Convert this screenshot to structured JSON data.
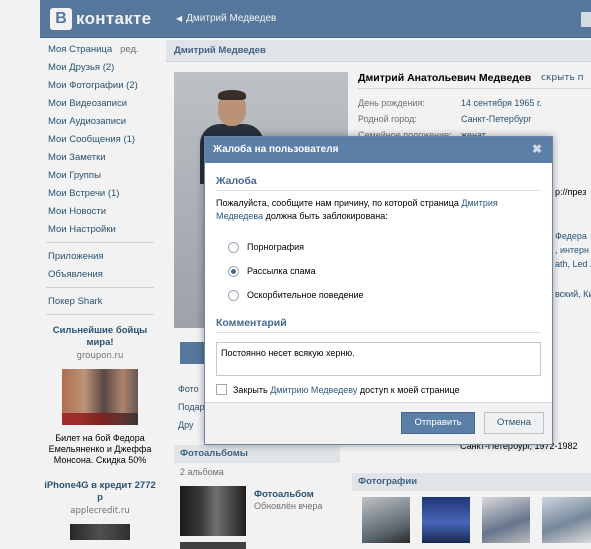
{
  "topbar": {
    "logo_letter": "В",
    "logo_text": "контакте",
    "back_link": "Дмитрий Медведев"
  },
  "menu": {
    "items": [
      {
        "label": "Моя Страница",
        "extra": "ред."
      },
      {
        "label": "Мои Друзья (2)"
      },
      {
        "label": "Мои Фотографии (2)"
      },
      {
        "label": "Мои Видеозаписи"
      },
      {
        "label": "Мои Аудиозаписи"
      },
      {
        "label": "Мои Сообщения (1)"
      },
      {
        "label": "Мои Заметки"
      },
      {
        "label": "Мои Группы"
      },
      {
        "label": "Мои Встречи (1)"
      },
      {
        "label": "Мои Новости"
      },
      {
        "label": "Мои Настройки"
      }
    ],
    "extra_items": [
      "Приложения",
      "Объявления"
    ],
    "game": "Покер Shark"
  },
  "ads": [
    {
      "title": "Сильнейшие бойцы мира!",
      "source": "groupon.ru",
      "text": "Билет на бой Федора Емельяненко и Джеффа Монсона. Скидка 50%"
    },
    {
      "title": "iPhone4G в кредит 2772 р",
      "source": "applecredit.ru"
    }
  ],
  "content": {
    "header": "Дмитрий Медведев",
    "profile_name": "Дмитрий Анатольевич Медведев",
    "hide_link": "скрыть п",
    "info": [
      {
        "k": "День рождения:",
        "v": "14 сентября 1965 г."
      },
      {
        "k": "Родной город:",
        "v": "Санкт-Петербург"
      },
      {
        "k": "Семейное положение:",
        "v": "женат"
      }
    ],
    "peek_right": {
      "site": "p://през",
      "r1": "Федера",
      "r2": ", интерн",
      "r3": "ath, Led Z",
      "r4": "вский, Ки"
    },
    "left_under": {
      "a": "Фото",
      "b": "Подар",
      "c": "Дру"
    },
    "study": "Санкт-Петербург, 1972-1982",
    "albums_head": "Фотоальбомы",
    "albums_count": "2 альбома",
    "album_title": "Фотоальбом",
    "album_date": "Обновлён вчера",
    "photos_head": "Фотографии"
  },
  "modal": {
    "title": "Жалоба на пользователя",
    "close_glyph": "✖",
    "section_title": "Жалоба",
    "desc_before": "Пожалуйста, сообщите нам причину, по которой страница",
    "desc_link": "Дмитрия Медведева",
    "desc_after": "должна быть заблокирована:",
    "reasons": [
      {
        "label": "Порнография",
        "checked": false
      },
      {
        "label": "Рассылка спама",
        "checked": true
      },
      {
        "label": "Оскорбительное поведение",
        "checked": false
      }
    ],
    "comment_title": "Комментарий",
    "comment_value": "Постоянно несет всякую херню.",
    "close_access_before": "Закрыть",
    "close_access_link": "Дмитрию Медведеву",
    "close_access_after": "доступ к моей странице",
    "send_label": "Отправить",
    "cancel_label": "Отмена"
  },
  "colors": {
    "header_blue": "#5b7fa6",
    "link_blue": "#2b587a",
    "section_blue": "#45688e"
  }
}
